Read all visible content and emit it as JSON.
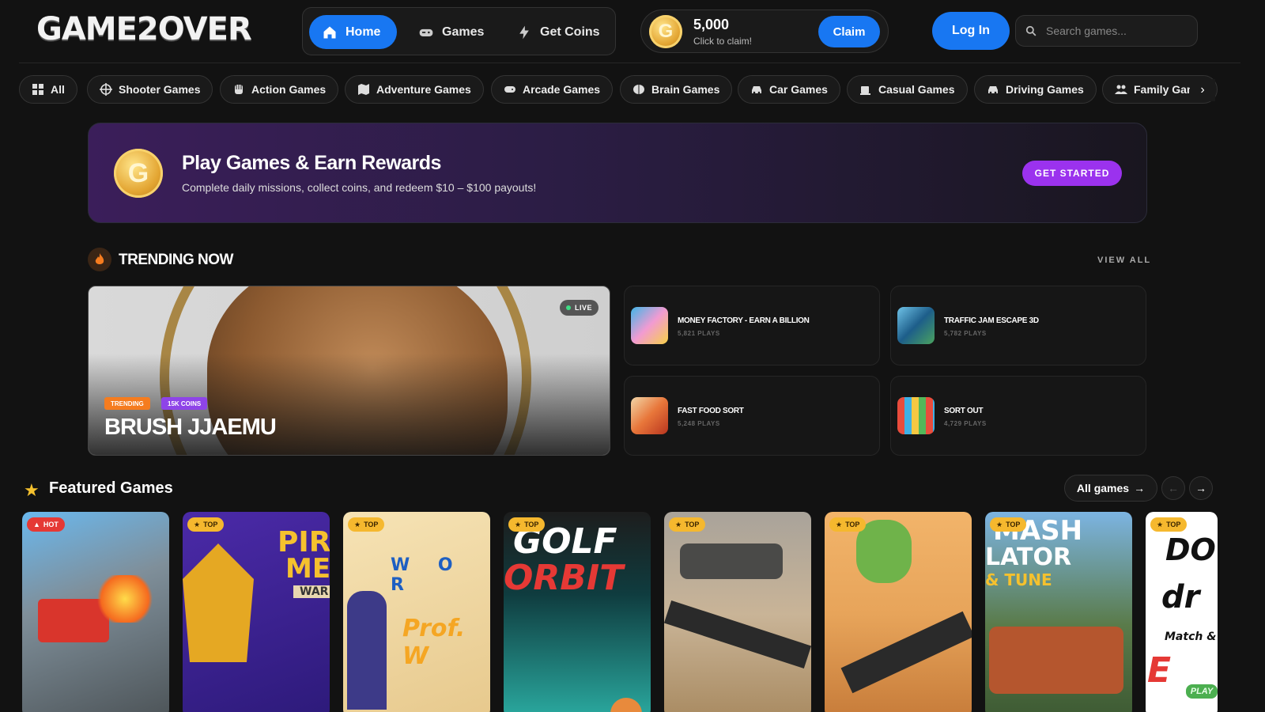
{
  "header": {
    "logo_text": "GAME2OVER",
    "nav": [
      {
        "label": "Home",
        "icon": "home-icon",
        "active": true
      },
      {
        "label": "Games",
        "icon": "gamepad-icon",
        "active": false
      },
      {
        "label": "Get Coins",
        "icon": "lightning-icon",
        "active": false
      }
    ],
    "coins": {
      "amount": "5,000",
      "subtitle": "Click to claim!",
      "claim_label": "Claim",
      "coin_letter": "G"
    },
    "login_label": "Log In",
    "search_placeholder": "Search games..."
  },
  "categories": [
    {
      "label": "All",
      "icon": "grid-icon"
    },
    {
      "label": "Shooter Games",
      "icon": "crosshair-icon"
    },
    {
      "label": "Action Games",
      "icon": "fist-icon"
    },
    {
      "label": "Adventure Games",
      "icon": "map-icon"
    },
    {
      "label": "Arcade Games",
      "icon": "gamepad-icon"
    },
    {
      "label": "Brain Games",
      "icon": "brain-icon"
    },
    {
      "label": "Car Games",
      "icon": "car-icon"
    },
    {
      "label": "Casual Games",
      "icon": "coffee-icon"
    },
    {
      "label": "Driving Games",
      "icon": "car-icon"
    },
    {
      "label": "Family Gam",
      "icon": "users-icon"
    }
  ],
  "banner": {
    "title": "Play Games & Earn Rewards",
    "subtitle": "Complete daily missions, collect coins, and redeem $10 – $100 payouts!",
    "cta": "GET STARTED",
    "coin_letter": "G"
  },
  "trending": {
    "title": "TRENDING NOW",
    "view_all": "VIEW ALL",
    "hero": {
      "title": "BRUSH JJAEMU",
      "live_label": "LIVE",
      "tag1": "TRENDING",
      "tag2": "15K COINS"
    },
    "cards": [
      {
        "name": "MONEY FACTORY - EARN A BILLION",
        "plays": "5,821 PLAYS"
      },
      {
        "name": "TRAFFIC JAM ESCAPE 3D",
        "plays": "5,782 PLAYS"
      },
      {
        "name": "FAST FOOD SORT",
        "plays": "5,248 PLAYS"
      },
      {
        "name": "SORT OUT",
        "plays": "4,729 PLAYS"
      }
    ]
  },
  "featured": {
    "title": "Featured Games",
    "all_games_label": "All games",
    "games": [
      {
        "badge": "HOT"
      },
      {
        "badge": "TOP",
        "art_text": "PIRA",
        "art_text2": "MER",
        "art_text3": "WAR"
      },
      {
        "badge": "TOP",
        "art_text": "W O R",
        "art_text2": "Prof. W"
      },
      {
        "badge": "TOP",
        "art_text": "GOLF",
        "art_text2": "ORBIT"
      },
      {
        "badge": "TOP"
      },
      {
        "badge": "TOP"
      },
      {
        "badge": "TOP",
        "art_text": "MASH",
        "art_text2": "LATOR",
        "art_text3": "& TUNE"
      },
      {
        "badge": "TOP",
        "art_text": "DO",
        "art_text2": "dr",
        "art_text3": "Match &",
        "art_text4": "E",
        "play_label": "PLAY"
      }
    ]
  },
  "colors": {
    "accent": "#1877f2",
    "purple": "#9b32ee",
    "gold": "#f5b82e",
    "hot": "#e53935",
    "background": "#121212"
  }
}
